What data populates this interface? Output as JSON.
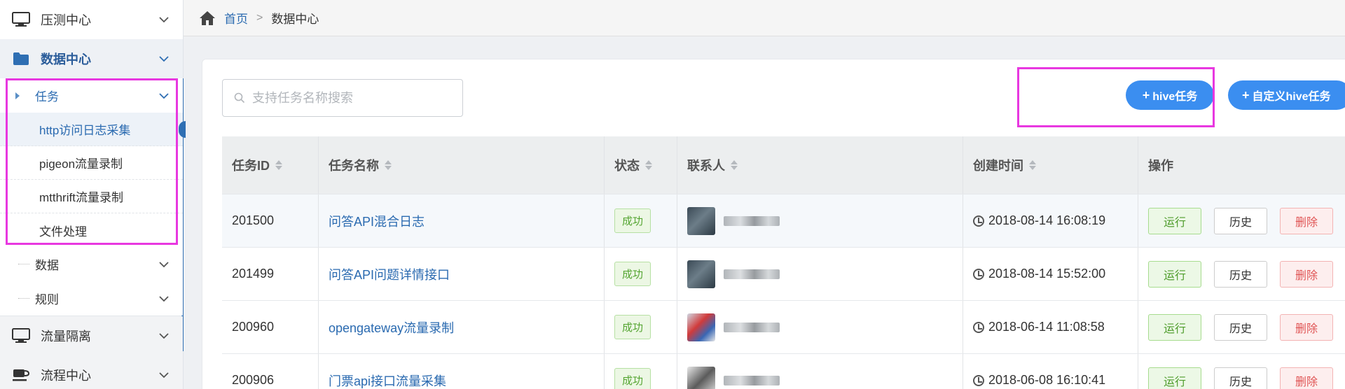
{
  "sidebar": {
    "sections": [
      {
        "label": "压测中心",
        "icon": "monitor-icon"
      },
      {
        "label": "数据中心",
        "icon": "folder-icon"
      },
      {
        "label": "流量隔离",
        "icon": "monitor-icon"
      },
      {
        "label": "流程中心",
        "icon": "coffee-cup-icon"
      }
    ],
    "sub": {
      "task": "任务",
      "task_items": [
        "http访问日志采集",
        "pigeon流量录制",
        "mtthrift流量录制",
        "文件处理"
      ],
      "data": "数据",
      "rules": "规则"
    }
  },
  "breadcrumb": {
    "home": "首页",
    "separator": ">",
    "current": "数据中心"
  },
  "search": {
    "placeholder": "支持任务名称搜索",
    "value": ""
  },
  "toolbar": {
    "hive_task": "hive任务",
    "custom_hive_task": "自定义hive任务",
    "plus": "+"
  },
  "table": {
    "headers": [
      "任务ID",
      "任务名称",
      "状态",
      "联系人",
      "创建时间",
      "操作"
    ],
    "rows": [
      {
        "id": "201500",
        "name": "问答API混合日志",
        "status": "成功",
        "created": "2018-08-14 16:08:19"
      },
      {
        "id": "201499",
        "name": "问答API问题详情接口",
        "status": "成功",
        "created": "2018-08-14 15:52:00"
      },
      {
        "id": "200960",
        "name": "opengateway流量录制",
        "status": "成功",
        "created": "2018-06-14 11:08:58"
      },
      {
        "id": "200906",
        "name": "门票api接口流量采集",
        "status": "成功",
        "created": "2018-06-08 16:10:41"
      }
    ],
    "actions": {
      "run": "运行",
      "history": "历史",
      "delete": "删除"
    }
  },
  "colors": {
    "primary": "#3b8ef0",
    "link": "#2a6ab0",
    "success": "#55a532",
    "danger": "#e05555",
    "highlight": "#e838e0"
  }
}
